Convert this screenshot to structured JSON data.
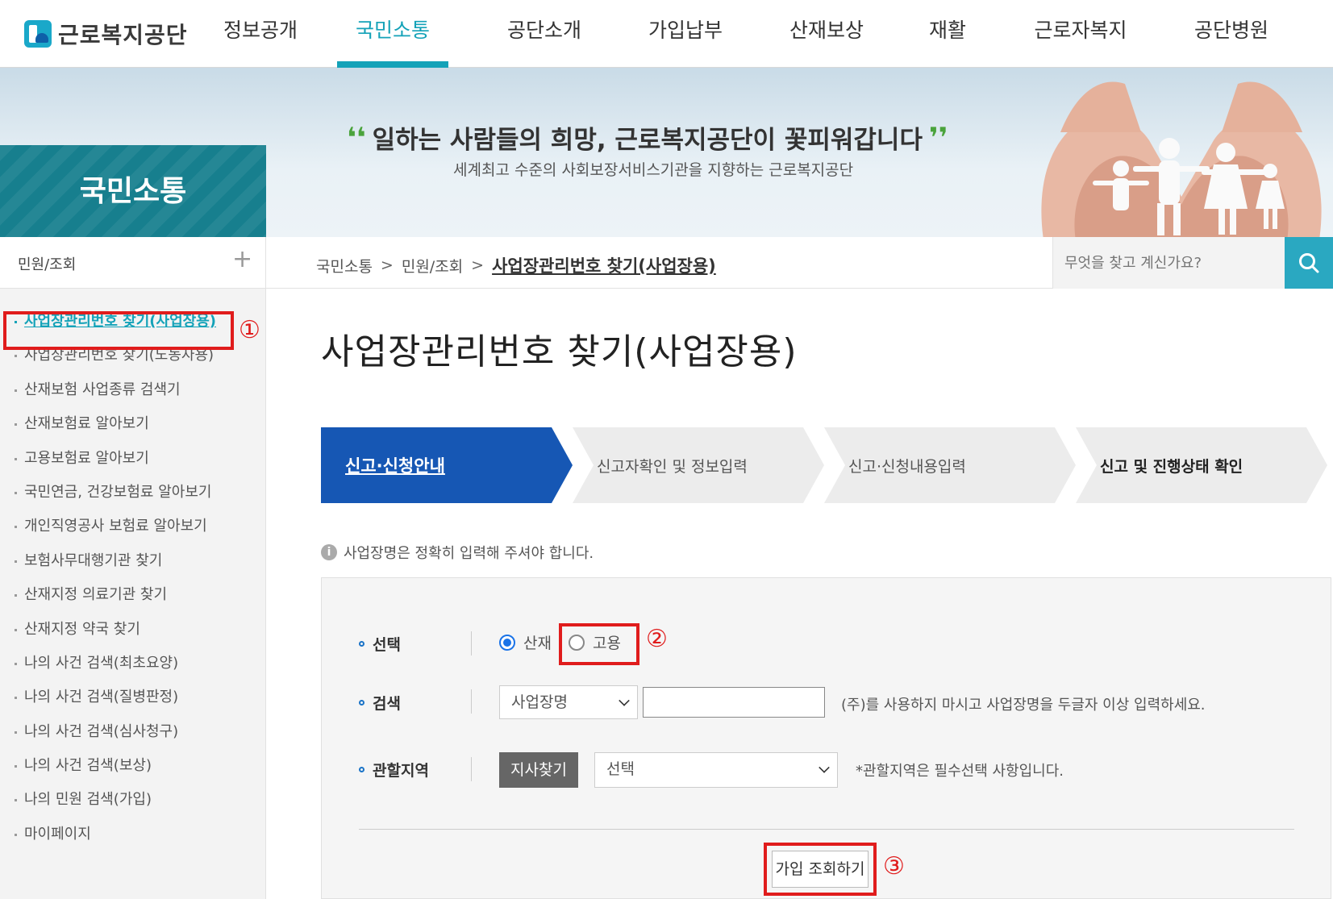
{
  "header": {
    "logo_text": "근로복지공단",
    "nav": [
      "정보공개",
      "국민소통",
      "공단소개",
      "가입납부",
      "산재보상",
      "재활",
      "근로자복지",
      "공단병원"
    ],
    "active_nav": "국민소통"
  },
  "hero": {
    "section_title": "국민소통",
    "slogan": "일하는 사람들의 희망, 근로복지공단이 꽃피워갑니다",
    "slogan_sub": "세계최고 수준의 사회보장서비스기관을 지향하는 근로복지공단"
  },
  "sidebar": {
    "header_label": "민원/조회",
    "header_toggle": "+",
    "items": [
      "사업장관리번호 찾기(사업장용)",
      "사업장관리번호 찾기(노동자용)",
      "산재보험 사업종류 검색기",
      "산재보험료 알아보기",
      "고용보험료 알아보기",
      "국민연금, 건강보험료 알아보기",
      "개인직영공사 보험료 알아보기",
      "보험사무대행기관 찾기",
      "산재지정 의료기관 찾기",
      "산재지정 약국 찾기",
      "나의 사건 검색(최초요양)",
      "나의 사건 검색(질병판정)",
      "나의 사건 검색(심사청구)",
      "나의 사건 검색(보상)",
      "나의 민원 검색(가입)",
      "마이페이지"
    ]
  },
  "breadcrumb": {
    "items": [
      "국민소통",
      "민원/조회"
    ],
    "current": "사업장관리번호 찾기(사업장용)",
    "separator": ">"
  },
  "search": {
    "placeholder": "무엇을 찾고 계신가요?"
  },
  "page": {
    "title": "사업장관리번호 찾기(사업장용)"
  },
  "steps": [
    "신고·신청안내",
    "신고자확인 및 정보입력",
    "신고·신청내용입력",
    "신고 및 진행상태 확인"
  ],
  "notice": "사업장명은 정확히 입력해 주셔야 합니다.",
  "form": {
    "select_label": "선택",
    "radio_options": [
      "산재",
      "고용"
    ],
    "radio_selected": "산재",
    "search_label": "검색",
    "search_type_value": "사업장명",
    "search_value": "",
    "search_hint": "(주)를 사용하지 마시고 사업장명을 두글자 이상 입력하세요.",
    "region_label": "관할지역",
    "find_branch_button": "지사찾기",
    "region_value": "선택",
    "region_hint": "*관할지역은 필수선택 사항입니다.",
    "submit_button": "가입 조회하기"
  },
  "annotations": [
    "①",
    "②",
    "③"
  ],
  "colors": {
    "accent": "#14a2b8",
    "step_active": "#1657b4",
    "annotation": "#e01c1c"
  }
}
